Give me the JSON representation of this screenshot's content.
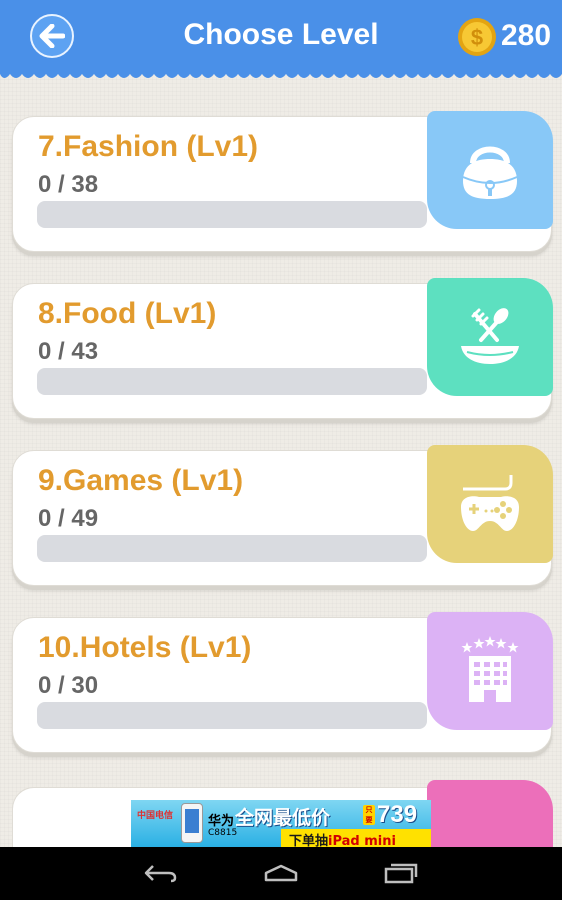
{
  "header": {
    "title": "Choose Level",
    "coins": "280"
  },
  "levels": [
    {
      "name": "7.Fashion (Lv1)",
      "progress_text": "0 / 38",
      "progress": 0,
      "icon": "handbag-icon",
      "color": "#88c8f7"
    },
    {
      "name": "8.Food (Lv1)",
      "progress_text": "0 / 43",
      "progress": 0,
      "icon": "fork-spoon-bowl-icon",
      "color": "#5de0c0"
    },
    {
      "name": "9.Games (Lv1)",
      "progress_text": "0 / 49",
      "progress": 0,
      "icon": "gamepad-icon",
      "color": "#e6d27a"
    },
    {
      "name": "10.Hotels (Lv1)",
      "progress_text": "0 / 30",
      "progress": 0,
      "icon": "hotel-icon",
      "color": "#dcb2f5"
    }
  ],
  "next_partial": {
    "color": "#ec6fba"
  },
  "ad": {
    "logo_text": "中国电信",
    "brand": "华为",
    "model": "C8815",
    "headline": "全网最低价",
    "badge": "只要",
    "price": "739",
    "sub_prefix": "下单抽",
    "sub_highlight": "iPad mini"
  },
  "colors": {
    "header": "#4a90e8",
    "level_name": "#e29b2e",
    "progress_track": "#d9dbe0"
  }
}
